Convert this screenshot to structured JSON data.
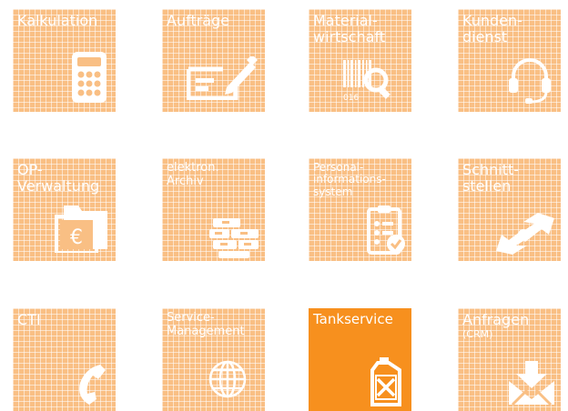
{
  "tiles": [
    {
      "key": "kalkulation",
      "lines": [
        "Kalkulation"
      ],
      "icon": "calculator-icon"
    },
    {
      "key": "auftraege",
      "lines": [
        "Aufträge"
      ],
      "icon": "order-form-pen-icon"
    },
    {
      "key": "materialwirtschaft",
      "lines": [
        "Material-",
        "wirtschaft"
      ],
      "icon": "barcode-magnifier-icon",
      "icon_text": "016"
    },
    {
      "key": "kundendienst",
      "lines": [
        "Kunden-",
        "dienst"
      ],
      "icon": "headset-icon"
    },
    {
      "key": "op_verwaltung",
      "lines": [
        "OP-",
        "Verwaltung"
      ],
      "icon": "euro-folder-icon",
      "icon_text": "€"
    },
    {
      "key": "elektron_archiv",
      "lines": [
        "elektron.",
        "Archiv"
      ],
      "icon": "archive-stack-icon"
    },
    {
      "key": "personalinformationssystem",
      "lines": [
        "Personal-",
        "informations-",
        "system"
      ],
      "icon": "clipboard-check-icon"
    },
    {
      "key": "schnittstellen",
      "lines": [
        "Schnitt-",
        "stellen"
      ],
      "icon": "interface-arrows-icon"
    },
    {
      "key": "cti",
      "lines": [
        "CTI"
      ],
      "icon": "phone-handset-icon"
    },
    {
      "key": "service_management",
      "lines": [
        "Service-",
        "Management"
      ],
      "icon": "globe-icon"
    },
    {
      "key": "tankservice",
      "lines": [
        "Tankservice"
      ],
      "icon": "fuel-canister-icon",
      "active": true
    },
    {
      "key": "anfragen",
      "lines": [
        "Anfragen"
      ],
      "sub": "(CRM)",
      "icon": "inbox-download-icon"
    }
  ],
  "colors": {
    "tile": "#f9bf84",
    "active": "#f7901e",
    "icon": "#ffffff"
  }
}
